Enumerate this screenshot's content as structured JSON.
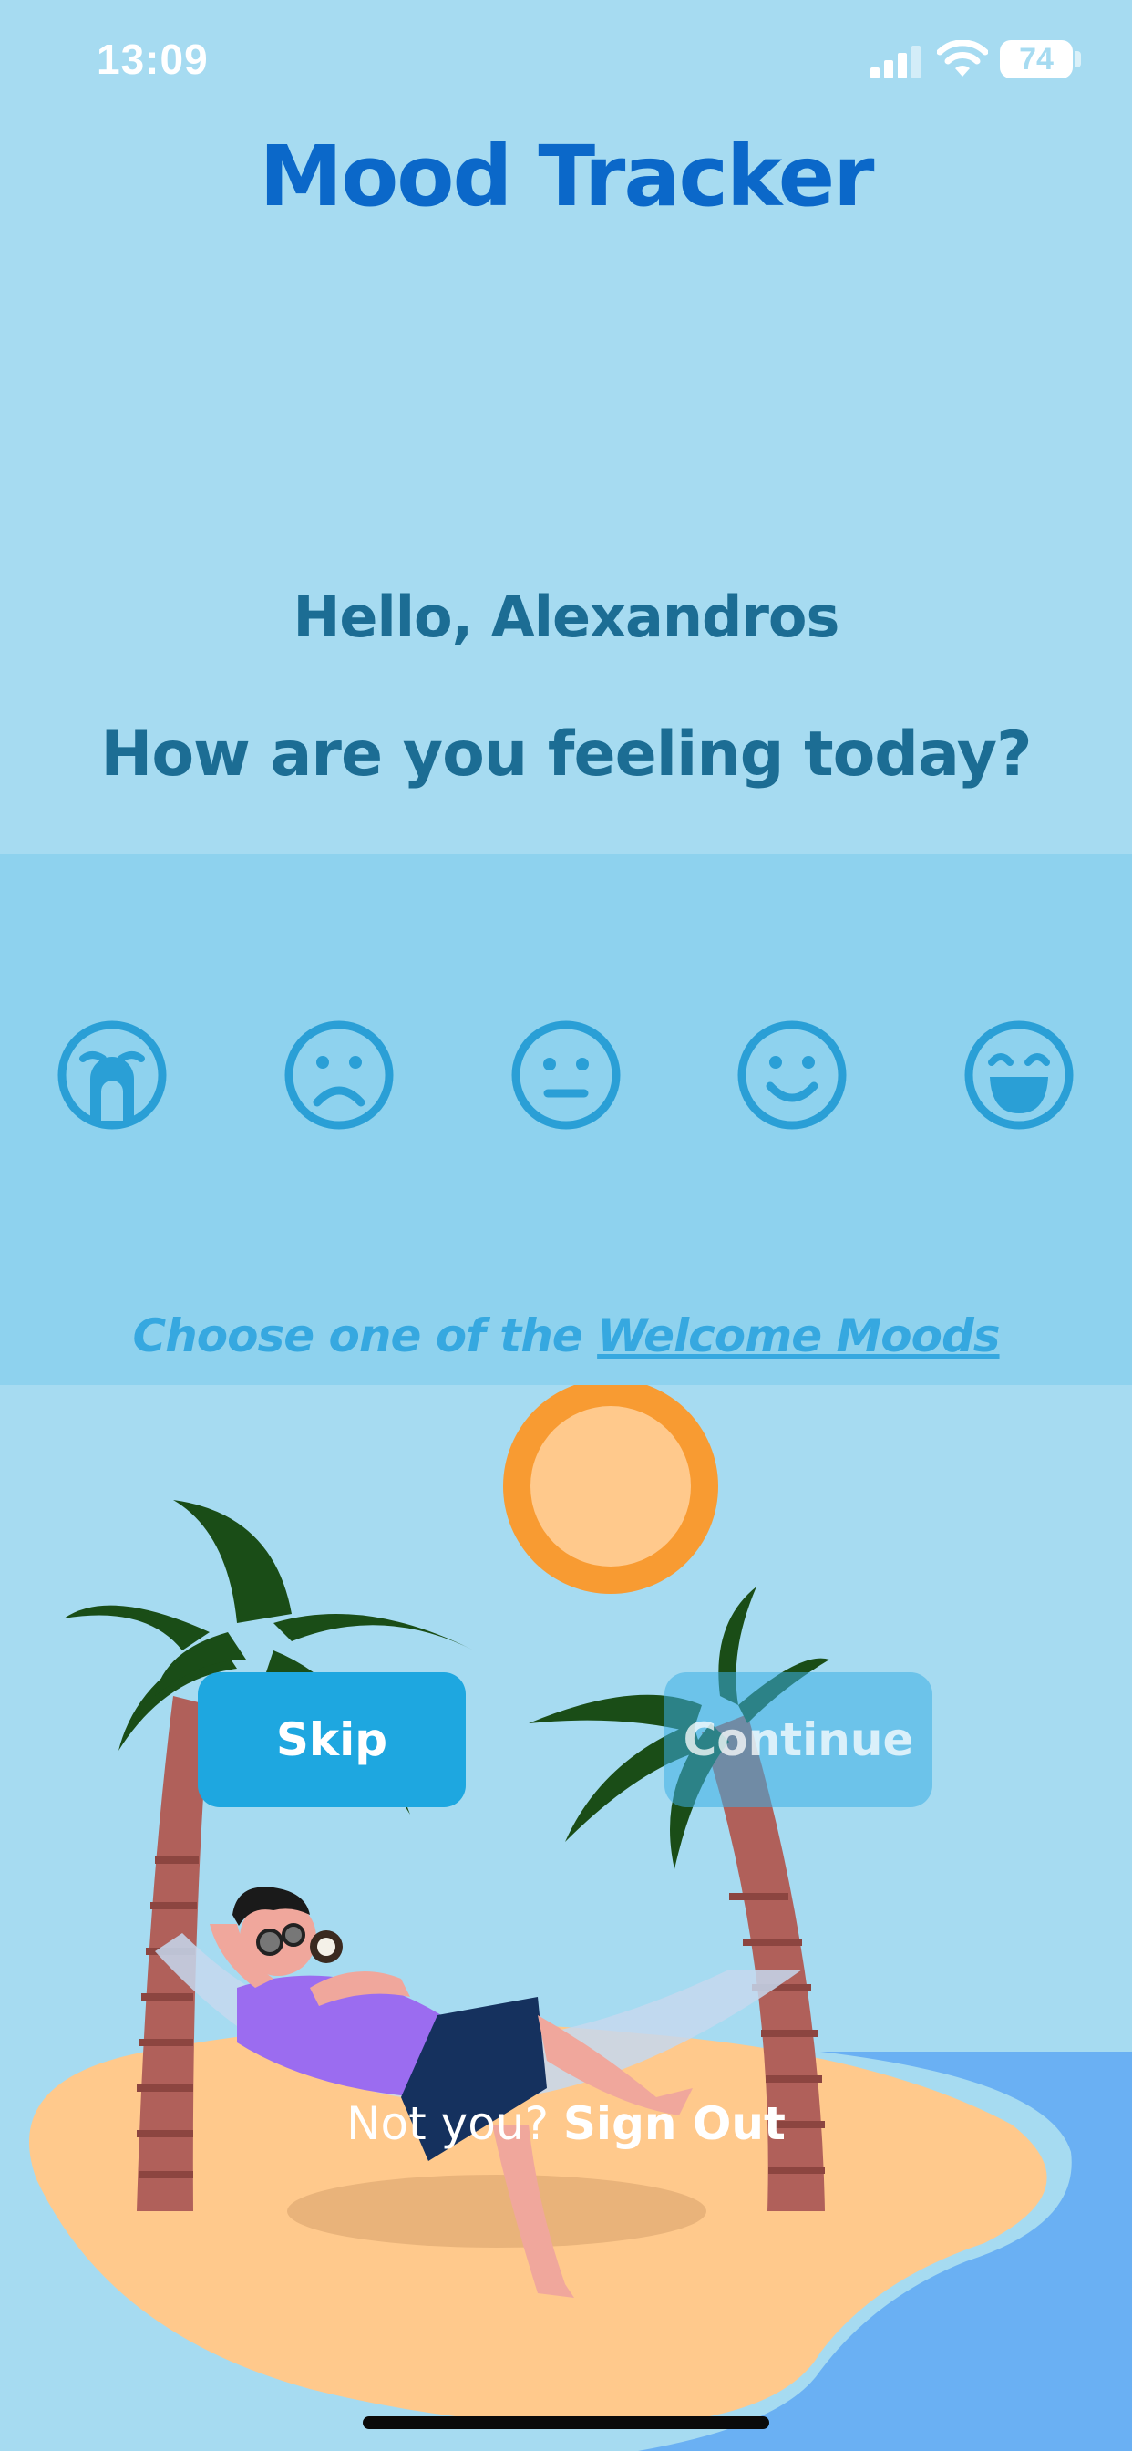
{
  "status": {
    "time": "13:09",
    "battery": "74"
  },
  "app": {
    "title": "Mood Tracker"
  },
  "greeting": {
    "hello": "Hello, Alexandros",
    "question": "How are you feeling today?"
  },
  "moods": [
    {
      "icon": "crying-face-icon"
    },
    {
      "icon": "frowning-face-icon"
    },
    {
      "icon": "neutral-face-icon"
    },
    {
      "icon": "smiling-face-icon"
    },
    {
      "icon": "grinning-face-icon"
    }
  ],
  "choose": {
    "prefix": "Choose one of the ",
    "link": "Welcome Moods"
  },
  "buttons": {
    "skip": "Skip",
    "continue": "Continue"
  },
  "signout": {
    "prompt": "Not you?",
    "action": "Sign Out"
  },
  "colors": {
    "background": "#a6dbf1",
    "band": "#8ed2ee",
    "title": "#0b68c9",
    "mood_icon": "#2a9fd6",
    "skip": "#1ea7e0"
  }
}
